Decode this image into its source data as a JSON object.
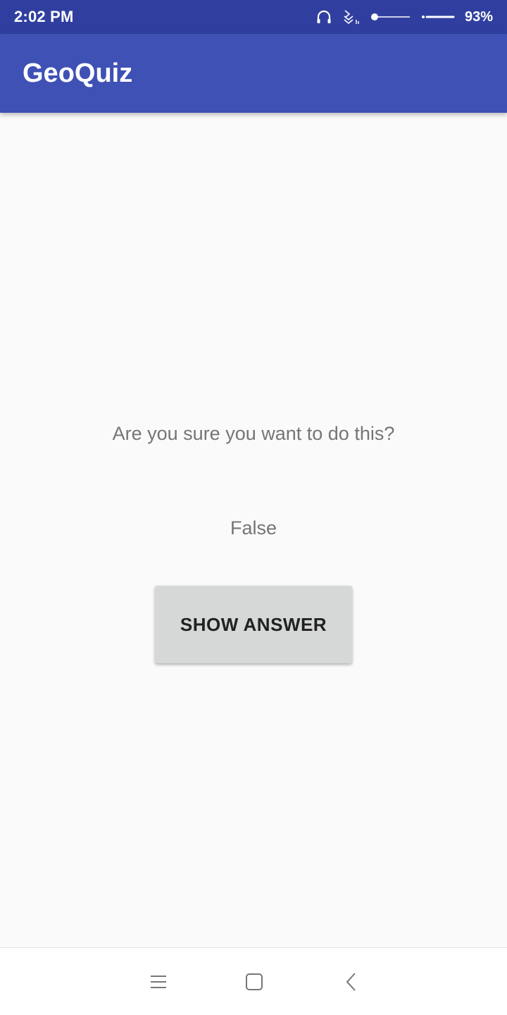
{
  "status_bar": {
    "time": "2:02 PM",
    "battery_percent": "93%",
    "icons": [
      "headphones-icon",
      "signal-icon",
      "brightness-slider-icon",
      "wifi-line-icon"
    ]
  },
  "app_bar": {
    "title": "GeoQuiz",
    "color": "#3f51b5",
    "status_color": "#303f9f"
  },
  "main": {
    "warning_text": "Are you sure you want to do this?",
    "answer_text": "False",
    "show_answer_button": "SHOW ANSWER"
  },
  "nav_bar": {
    "icons": [
      "menu-icon",
      "home-icon",
      "back-icon"
    ]
  }
}
